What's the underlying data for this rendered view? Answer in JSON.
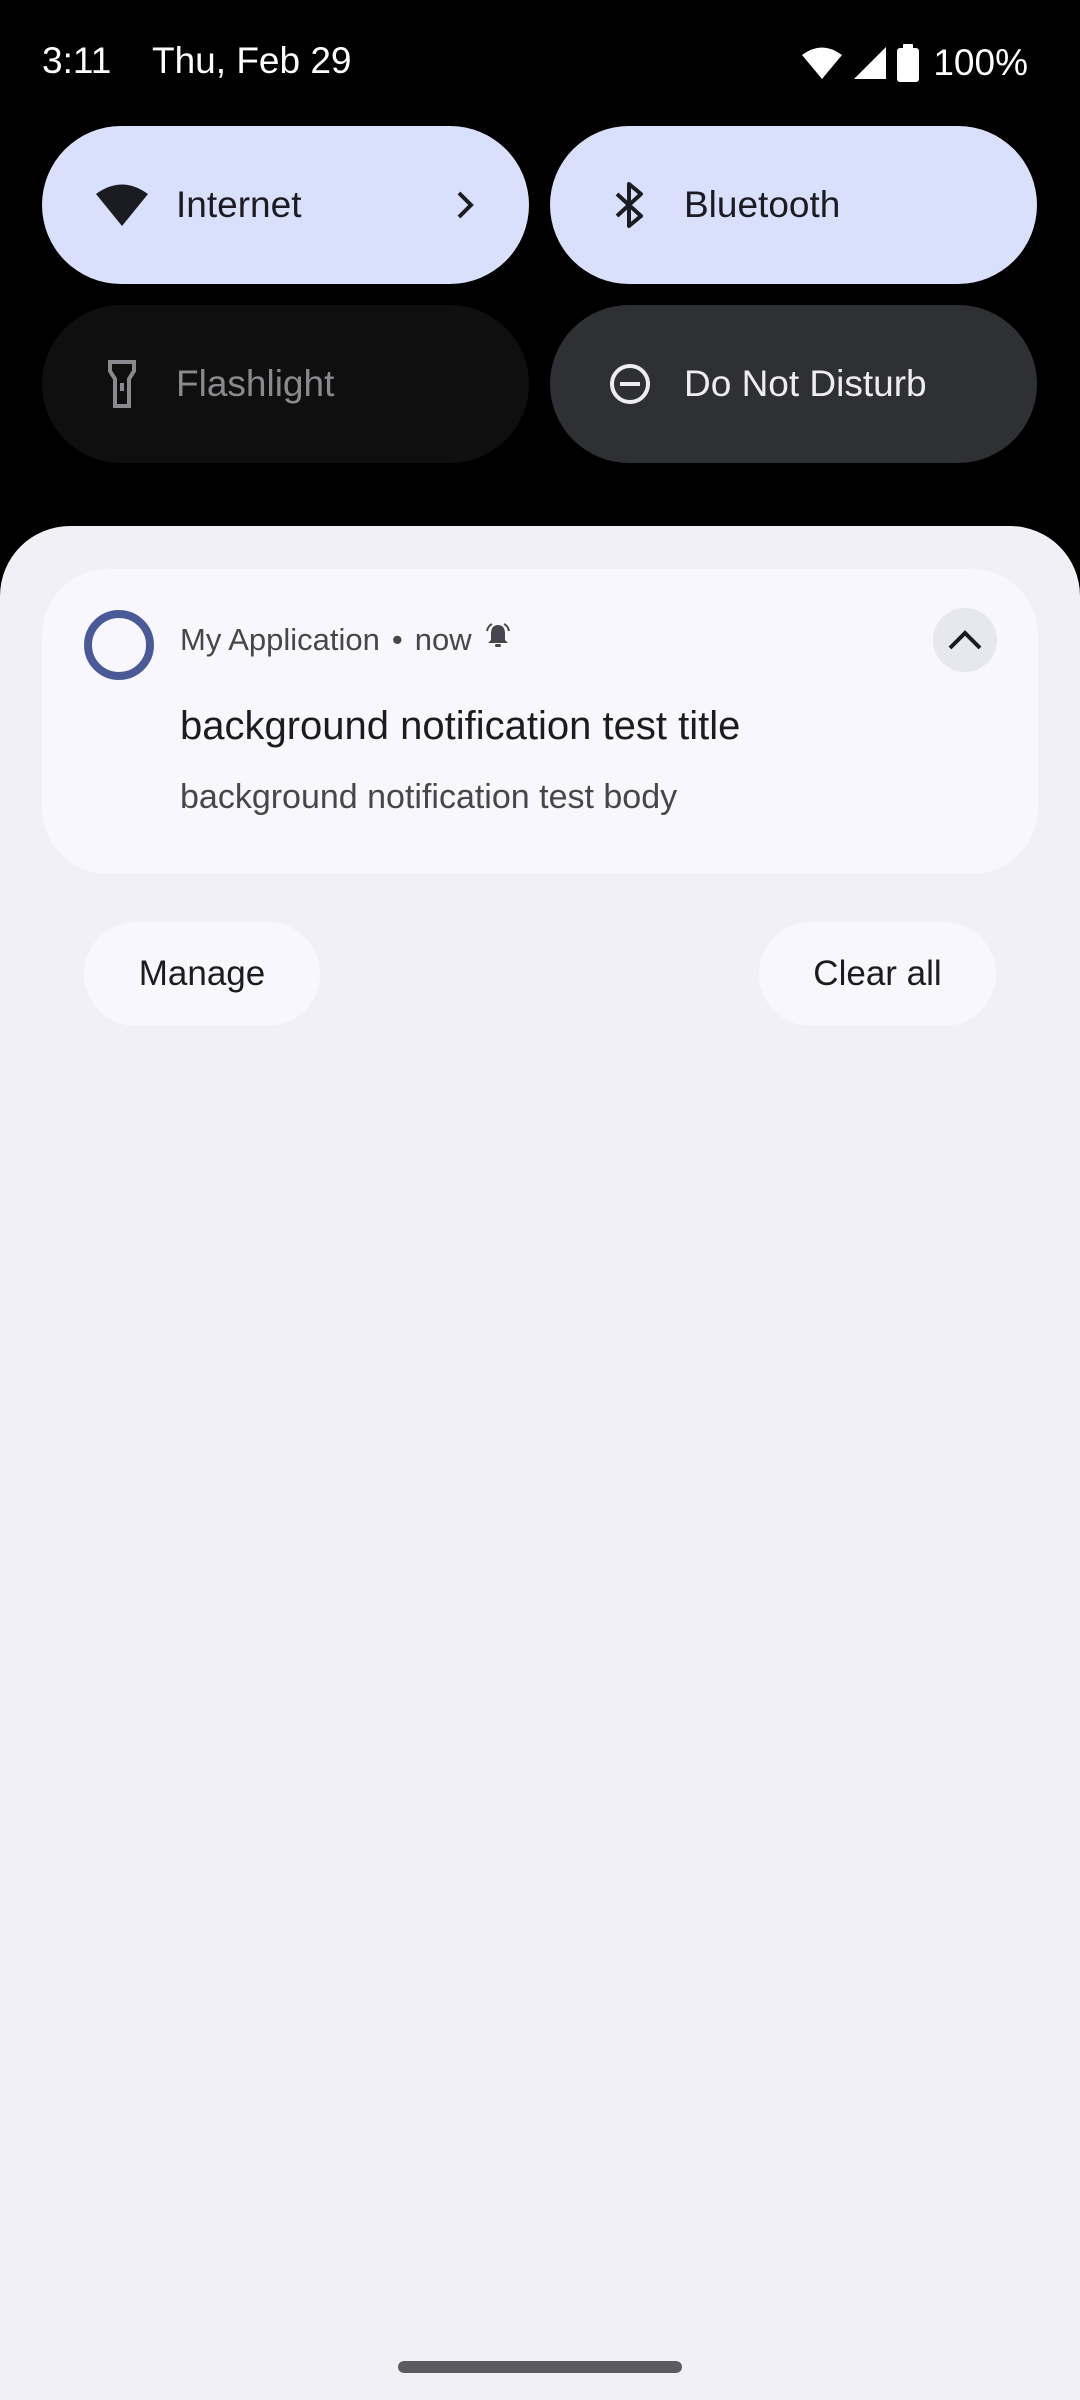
{
  "status_bar": {
    "time": "3:11",
    "date": "Thu, Feb 29",
    "battery": "100%",
    "icons": [
      "wifi-icon",
      "cell-signal-icon",
      "battery-icon"
    ]
  },
  "quick_settings": {
    "tiles": [
      {
        "label": "Internet",
        "icon": "wifi-icon",
        "state": "on"
      },
      {
        "label": "Bluetooth",
        "icon": "bluetooth-icon",
        "state": "on"
      },
      {
        "label": "Flashlight",
        "icon": "flashlight-icon",
        "state": "off"
      },
      {
        "label": "Do Not Disturb",
        "icon": "do-not-disturb-icon",
        "state": "off"
      }
    ]
  },
  "notification": {
    "app_name": "My Application",
    "separator": "•",
    "time": "now",
    "title": "background notification test title",
    "body": "background notification test body",
    "alert_icon": "alerting-bell-icon",
    "expand_icon": "chevron-up-icon"
  },
  "actions": {
    "manage": "Manage",
    "clear_all": "Clear all"
  },
  "colors": {
    "tile_on": "#d9e0fb",
    "tile_off": "#0f0f10",
    "tile_dnd": "#2f3034",
    "shade_bg": "#f0f0f6",
    "card_bg": "#f8f7fd",
    "app_icon_ring": "#4a5a98"
  }
}
